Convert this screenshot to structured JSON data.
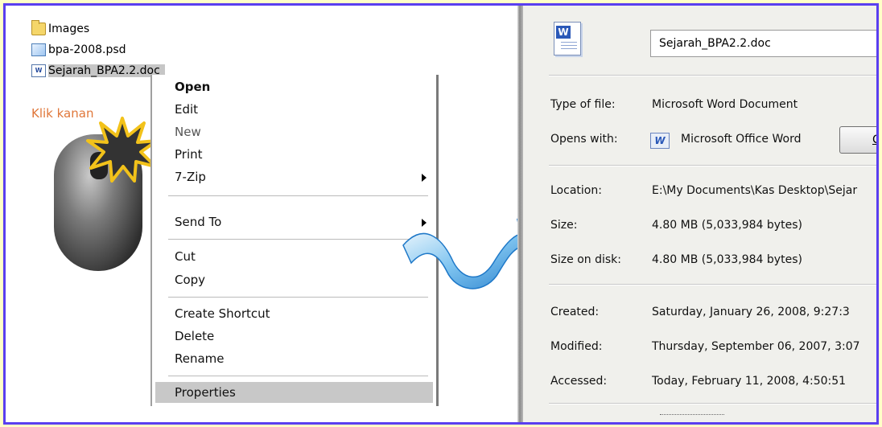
{
  "explorer": {
    "files": [
      {
        "name": "Images",
        "icon": "folder-icon"
      },
      {
        "name": "bpa-2008.psd",
        "icon": "psd-file-icon"
      },
      {
        "name": "Sejarah_BPA2.2.doc",
        "display": "Sejarah_BPA2.2.doc",
        "icon": "word-doc-icon"
      }
    ],
    "caption": "Klik kanan"
  },
  "context_menu": {
    "items": [
      {
        "label": "Open",
        "style": "bold"
      },
      {
        "label": "Edit"
      },
      {
        "label": "New",
        "style": "dim"
      },
      {
        "label": "Print"
      },
      {
        "label": "7-Zip",
        "submenu": true
      },
      {
        "label": "Send To",
        "submenu": true
      },
      {
        "label": "Cut"
      },
      {
        "label": "Copy"
      },
      {
        "label": "Create Shortcut"
      },
      {
        "label": "Delete"
      },
      {
        "label": "Rename"
      },
      {
        "label": "Properties",
        "highlighted": true
      }
    ]
  },
  "properties": {
    "filename": "Sejarah_BPA2.2.doc",
    "type_label": "Type of file:",
    "type_value": "Microsoft Word Document",
    "opens_label": "Opens with:",
    "opens_value": "Microsoft Office Word",
    "change_button": "Ch",
    "location_label": "Location:",
    "location_value": "E:\\My Documents\\Kas Desktop\\Sejar",
    "size_label": "Size:",
    "size_value": "4.80 MB (5,033,984 bytes)",
    "size_disk_label": "Size on disk:",
    "size_disk_value": "4.80 MB (5,033,984 bytes)",
    "created_label": "Created:",
    "created_value": "Saturday, January 26, 2008, 9:27:3",
    "modified_label": "Modified:",
    "modified_value": "Thursday, September 06, 2007, 3:07",
    "accessed_label": "Accessed:",
    "accessed_value": "Today, February 11, 2008, 4:50:51"
  },
  "colors": {
    "frame_border": "#5a3ff0",
    "outer_background": "#ffffc8",
    "caption": "#e0773a",
    "highlight": "#c8c8c8"
  }
}
